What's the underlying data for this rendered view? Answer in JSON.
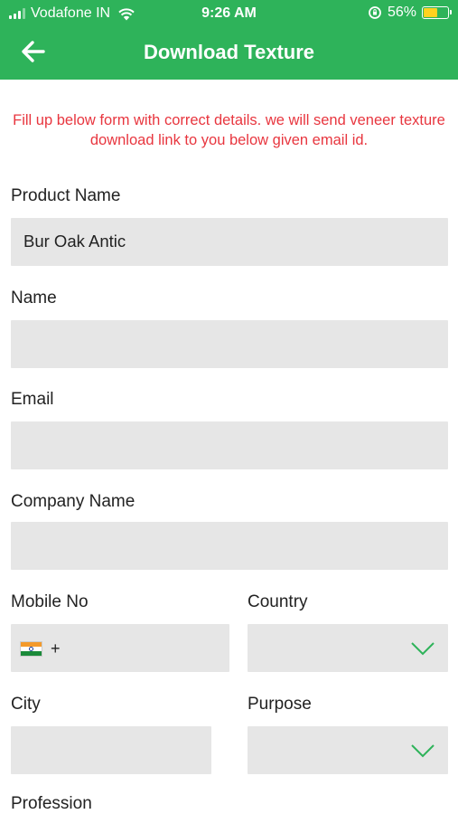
{
  "status_bar": {
    "carrier": "Vodafone IN",
    "time": "9:26 AM",
    "battery_pct": "56%",
    "battery_level": 0.56
  },
  "header": {
    "title": "Download Texture"
  },
  "notice": "Fill up below form with correct details. we will send veneer texture download link to you below given email id.",
  "form": {
    "product_name": {
      "label": "Product Name",
      "value": "Bur Oak Antic"
    },
    "name": {
      "label": "Name",
      "value": ""
    },
    "email": {
      "label": "Email",
      "value": ""
    },
    "company_name": {
      "label": "Company Name",
      "value": ""
    },
    "mobile_no": {
      "label": "Mobile No",
      "prefix": "+"
    },
    "country": {
      "label": "Country",
      "value": ""
    },
    "city": {
      "label": "City",
      "value": ""
    },
    "purpose": {
      "label": "Purpose",
      "value": ""
    },
    "profession": {
      "label": "Profession"
    }
  },
  "colors": {
    "header": "#2eb35a",
    "notice": "#e8363f",
    "field": "#e6e6e6",
    "chevron": "#2eb35a",
    "battery": "#ffd21f"
  },
  "icons": {
    "back": "arrow-left-icon",
    "dropdown": "chevron-down-icon",
    "flag": "india-flag-icon"
  }
}
